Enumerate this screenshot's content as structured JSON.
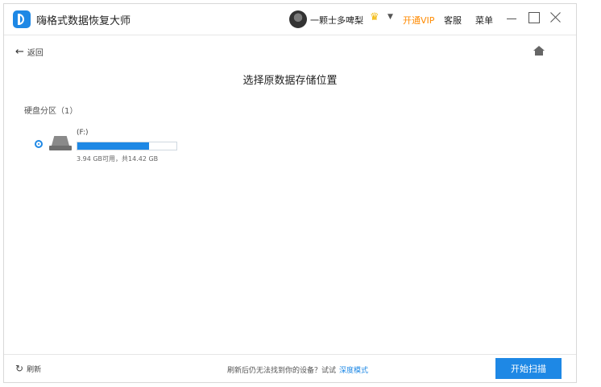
{
  "titlebar": {
    "app_title": "嗨格式数据恢复大师",
    "username": "一颗士多啤梨",
    "vip_label": "开通VIP",
    "service_label": "客服",
    "menu_label": "菜单",
    "crown_glyph": "♛",
    "caret_glyph": "▼"
  },
  "nav": {
    "back_glyph": "←",
    "back_label": "返回"
  },
  "main": {
    "title": "选择原数据存储位置",
    "section_label": "硬盘分区（1）",
    "drives": [
      {
        "name": "(F:)",
        "usage_percent": 72.7,
        "info": "3.94 GB可用，共14.42 GB"
      }
    ]
  },
  "footer": {
    "refresh_glyph": "↻",
    "refresh_label": "刷新",
    "hint_text": "刷新后仍无法找到你的设备？试试",
    "hint_link": "深度模式",
    "scan_button": "开始扫描"
  },
  "colors": {
    "accent": "#1e88e5",
    "vip": "#ff8a00",
    "crown": "#f2b600"
  }
}
